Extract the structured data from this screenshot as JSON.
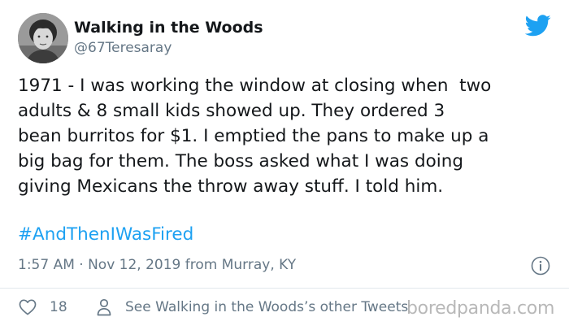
{
  "author": {
    "display_name": "Walking in the Woods",
    "handle": "@67Teresaray",
    "avatar": "avatar"
  },
  "brand": {
    "icon": "twitter-bird-icon",
    "color": "#1da1f2"
  },
  "tweet": {
    "text": "1971 - I was working the window at closing when  two\nadults & 8 small kids showed up. They ordered 3\nbean burritos for $1. I emptied the pans to make up a\nbig bag for them. The boss asked what I was doing\ngiving Mexicans the throw away stuff. I told him.",
    "hashtag": "#AndThenIWasFired",
    "meta": "1:57 AM · Nov 12, 2019 from Murray, KY"
  },
  "actions": {
    "like_count": "18",
    "other_tweets_label": "See Walking in the Woods’s other Tweets",
    "like_icon": "heart-icon",
    "person_icon": "person-icon",
    "info_icon": "info-icon"
  },
  "watermark": {
    "text": "boredpanda.com"
  }
}
